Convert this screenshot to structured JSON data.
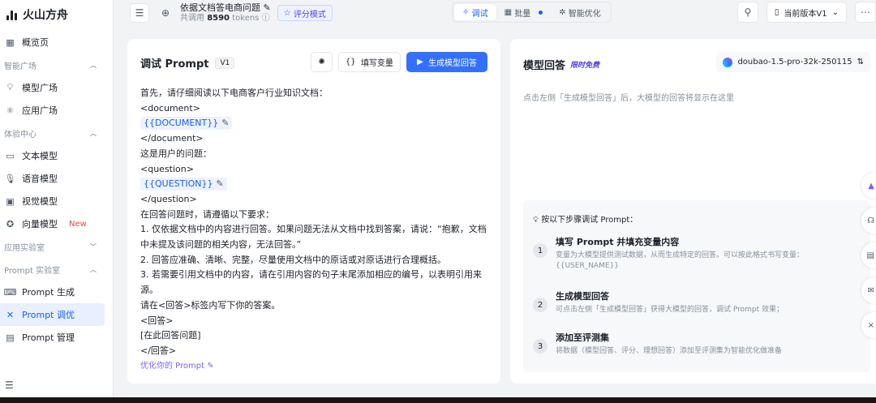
{
  "app": {
    "name": "火山方舟"
  },
  "sidebar": {
    "overview": "概览页",
    "groups": [
      {
        "label": "智能广场",
        "items": [
          "模型广场",
          "应用广场"
        ]
      },
      {
        "label": "体验中心",
        "items": [
          "文本模型",
          "语音模型",
          "视觉模型",
          "向量模型"
        ]
      },
      {
        "label": "应用实验室",
        "items": []
      },
      {
        "label": "Prompt 实验室",
        "items": [
          "Prompt 生成",
          "Prompt 调优",
          "Prompt 管理"
        ]
      }
    ],
    "new_badge": "New"
  },
  "header": {
    "doc_title": "依据文档答电商问题",
    "tokens_prefix": "共调用",
    "tokens_value": "8590",
    "tokens_suffix": "tokens",
    "eval_mode": "评分模式",
    "tabs": [
      "调试",
      "批量",
      "智能优化"
    ],
    "version": "当前版本V1"
  },
  "left": {
    "title": "调试 Prompt",
    "version_tag": "V1",
    "fill_vars": "填写变量",
    "generate": "生成模型回答",
    "lines": [
      "首先，请仔细阅读以下电商客户行业知识文档：",
      "<document>",
      "{{DOCUMENT}}",
      "</document>",
      "这是用户的问题：",
      "<question>",
      "{{QUESTION}}",
      "</question>",
      "在回答问题时，请遵循以下要求：",
      "1. 仅依据文档中的内容进行回答。如果问题无法从文档中找到答案，请说：“抱歉，文档中未提及该问题的相关内容，无法回答。”",
      "2. 回答应准确、清晰、完整，尽量使用文档中的原话或对原话进行合理概括。",
      "3. 若需要引用文档中的内容，请在引用内容的句子末尾添加相应的编号，以表明引用来源。",
      "请在<回答>标签内写下你的答案。",
      "<回答>",
      "[在此回答问题]",
      "</回答>"
    ],
    "optimize": "优化你的 Prompt"
  },
  "right": {
    "title": "模型回答",
    "free_tag": "限时免费",
    "model": "doubao-1.5-pro-32k-250115",
    "placeholder": "点击左侧「生成模型回答」后，大模型的回答将显示在这里",
    "steps_head": "按以下步骤调试 Prompt：",
    "steps": [
      {
        "num": "1",
        "title": "填写 Prompt 并填充变量内容",
        "desc": "变量为大模型提供测试数据，从而生成特定的回答。可以按此格式书写变量：{{USER_NAME}}"
      },
      {
        "num": "2",
        "title": "生成模型回答",
        "desc": "可点击左侧「生成模型回答」获得大模型的回答，调试 Prompt 效果；"
      },
      {
        "num": "3",
        "title": "添加至评测集",
        "desc": "将数据（模型回答、评分、理想回答）添加至评测集为智能优化做准备"
      }
    ]
  },
  "colors": {
    "accent": "#3370ff",
    "active_bg": "#e8f0ff",
    "new_badge": "#f53f3f"
  }
}
